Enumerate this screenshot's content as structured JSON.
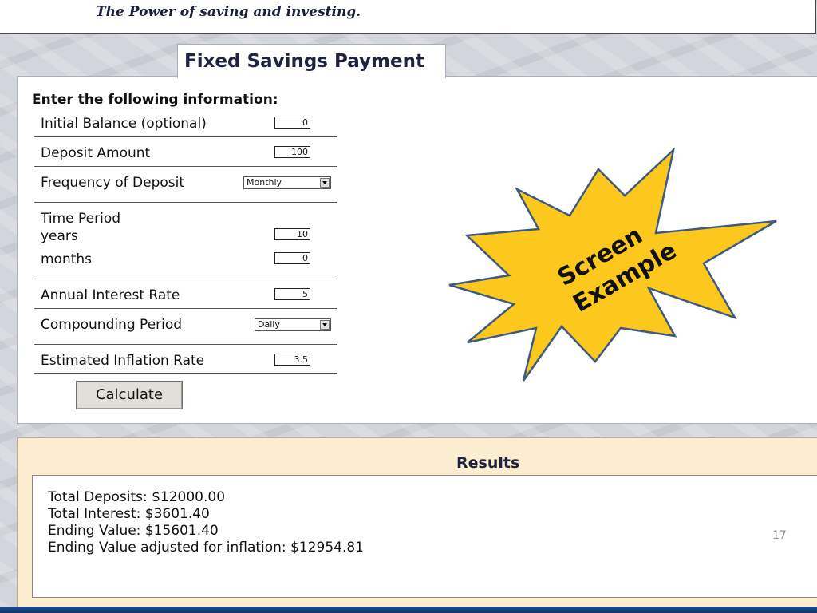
{
  "header": {
    "tagline": "The Power of saving and investing."
  },
  "calculator": {
    "title": "Fixed Savings Payment",
    "heading": "Enter the following information:",
    "fields": {
      "initial_balance": {
        "label": "Initial Balance (optional)",
        "value": "0"
      },
      "deposit_amount": {
        "label": "Deposit Amount",
        "value": "100"
      },
      "frequency": {
        "label": "Frequency of Deposit",
        "value": "Monthly"
      },
      "time_period": {
        "label": "Time Period",
        "years_label": "years",
        "years_value": "10",
        "months_label": "months",
        "months_value": "0"
      },
      "interest_rate": {
        "label": "Annual Interest Rate",
        "value": "5"
      },
      "compounding": {
        "label": "Compounding Period",
        "value": "Daily"
      },
      "inflation": {
        "label": "Estimated Inflation Rate",
        "value": "3.5"
      }
    },
    "calculate_label": "Calculate"
  },
  "callout": {
    "line1": "Screen",
    "line2": "Example",
    "fill": "#fcc81d",
    "stroke": "#3e5a80"
  },
  "results": {
    "title": "Results",
    "lines": [
      "Total Deposits: $12000.00",
      "Total Interest: $3601.40",
      "Ending Value: $15601.40",
      "Ending Value adjusted for inflation: $12954.81"
    ]
  },
  "slide": {
    "page_number": "17"
  }
}
